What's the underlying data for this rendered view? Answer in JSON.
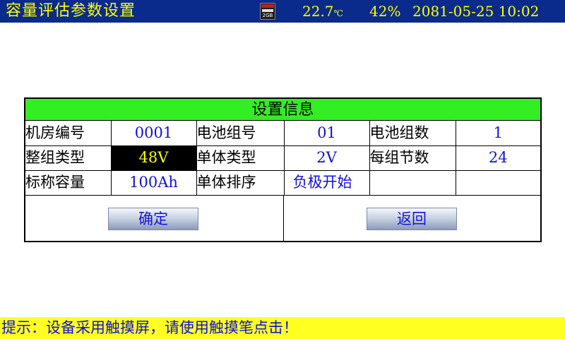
{
  "header": {
    "title": "容量评估参数设置",
    "sd_card": {
      "icon": "sd-card-icon",
      "capacity_label": "2GB"
    },
    "temperature": "22.7",
    "temperature_unit": "℃",
    "humidity": "42%",
    "datetime": "2081-05-25 10:02"
  },
  "panel": {
    "title": "设置信息",
    "rows": [
      [
        {
          "label": "机房编号",
          "value": "0001"
        },
        {
          "label": "电池组号",
          "value": "01"
        },
        {
          "label": "电池组数",
          "value": "1"
        }
      ],
      [
        {
          "label": "整组类型",
          "value": "48V",
          "selected": true
        },
        {
          "label": "单体类型",
          "value": "2V"
        },
        {
          "label": "每组节数",
          "value": "24"
        }
      ],
      [
        {
          "label": "标称容量",
          "value": "100Ah"
        },
        {
          "label": "单体排序",
          "value": "负极开始"
        },
        {
          "label": "",
          "value": ""
        }
      ]
    ],
    "confirm_label": "确定",
    "back_label": "返回"
  },
  "footer": {
    "hint": "提示：设备采用触摸屏，请使用触摸笔点击！"
  },
  "colors": {
    "title_bar": "#0a2a8c",
    "title_text": "#ffff00",
    "panel_header": "#33ee22",
    "value_text": "#1010d8",
    "selected_bg": "#000000",
    "selected_text": "#ffff00",
    "hint_bar": "#ffff22"
  }
}
